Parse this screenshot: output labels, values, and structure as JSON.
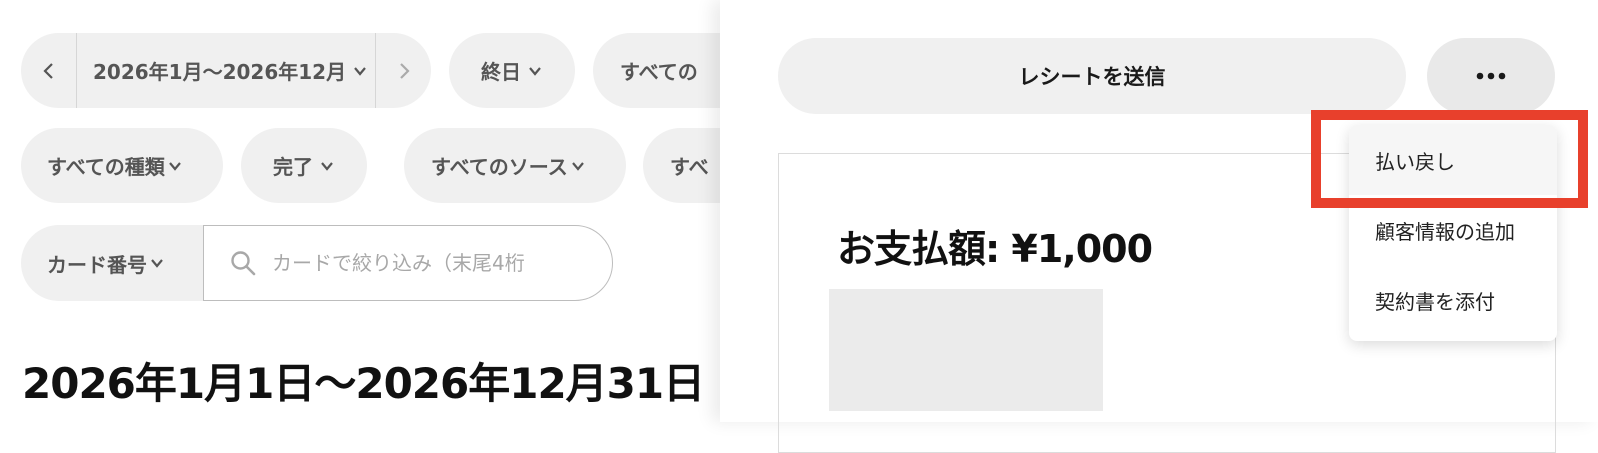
{
  "filters": {
    "date_range": {
      "label": "2026年1月〜2026年12月"
    },
    "time": {
      "label": "終日"
    },
    "status_partial": {
      "label": "すべての"
    },
    "type": {
      "label": "すべての種類"
    },
    "state": {
      "label": "完了"
    },
    "source": {
      "label": "すべてのソース"
    },
    "extra_partial": {
      "label": "すべ"
    },
    "card": {
      "label": "カード番号"
    }
  },
  "search": {
    "placeholder": "カードで絞り込み（末尾4桁"
  },
  "date_heading": "2026年1月1日〜2026年12月31日",
  "panel": {
    "send_receipt_label": "レシートを送信",
    "amount_label": "お支払額: ¥1,000"
  },
  "menu": {
    "items": [
      {
        "label": "払い戻し"
      },
      {
        "label": "顧客情報の追加"
      },
      {
        "label": "契約書を添付"
      }
    ]
  },
  "colors": {
    "highlight": "#e8402c",
    "pill_bg": "#f0f0f0"
  }
}
